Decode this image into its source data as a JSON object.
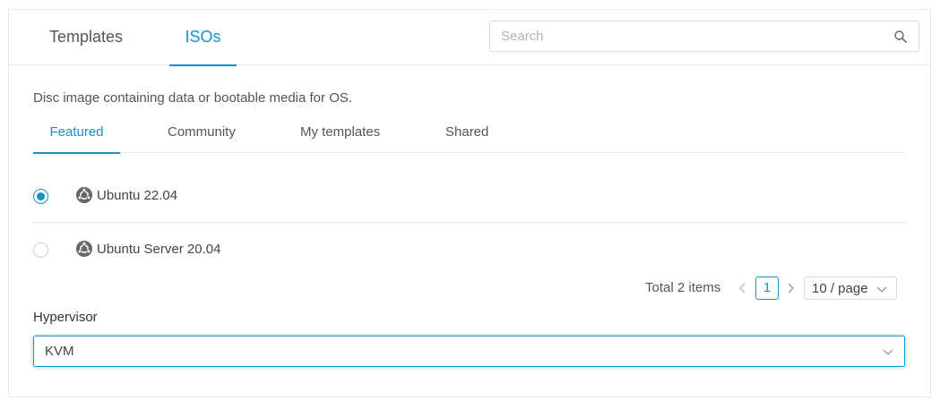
{
  "top_tabs": {
    "templates": "Templates",
    "isos": "ISOs",
    "active": "isos"
  },
  "search": {
    "placeholder": "Search",
    "value": ""
  },
  "description": "Disc image containing data or bootable media for OS.",
  "sub_tabs": {
    "featured": "Featured",
    "community": "Community",
    "my_templates": "My templates",
    "shared": "Shared",
    "active": "featured"
  },
  "options": [
    {
      "label": "Ubuntu 22.04",
      "selected": true,
      "icon": "ubuntu-icon"
    },
    {
      "label": "Ubuntu Server 20.04",
      "selected": false,
      "icon": "ubuntu-icon"
    }
  ],
  "pagination": {
    "total": "Total 2 items",
    "current_page": "1",
    "page_size": "10 / page"
  },
  "hypervisor": {
    "label": "Hypervisor",
    "value": "KVM"
  },
  "colors": {
    "accent": "#1890c9",
    "border": "#d9d9d9",
    "divider": "#e8e8e8",
    "icon": "#666666"
  }
}
